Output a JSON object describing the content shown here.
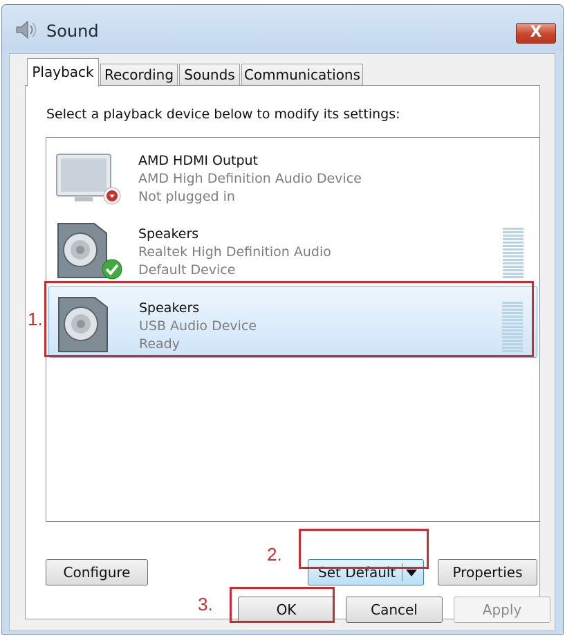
{
  "window": {
    "title": "Sound",
    "close_label": "X"
  },
  "tabs": [
    {
      "label": "Playback",
      "active": true
    },
    {
      "label": "Recording",
      "active": false
    },
    {
      "label": "Sounds",
      "active": false
    },
    {
      "label": "Communications",
      "active": false
    }
  ],
  "playback": {
    "instruction": "Select a playback device below to modify its settings:",
    "devices": [
      {
        "name": "AMD HDMI Output",
        "description": "AMD High Definition Audio Device",
        "status": "Not plugged in",
        "icon": "monitor-icon",
        "badge": "unplugged-badge-icon"
      },
      {
        "name": "Speakers",
        "description": "Realtek High Definition Audio",
        "status": "Default Device",
        "icon": "speaker-icon",
        "badge": "default-check-icon"
      },
      {
        "name": "Speakers",
        "description": "USB Audio Device",
        "status": "Ready",
        "icon": "speaker-icon",
        "selected": true
      }
    ]
  },
  "buttons": {
    "configure": "Configure",
    "set_default": "Set Default",
    "properties": "Properties",
    "ok": "OK",
    "cancel": "Cancel",
    "apply": "Apply"
  },
  "annotations": {
    "step1": "1.",
    "step2": "2.",
    "step3": "3."
  },
  "colors": {
    "annotation_red": "#c33030",
    "selection_blue": "#cfe4f8",
    "close_red": "#c8452b"
  }
}
